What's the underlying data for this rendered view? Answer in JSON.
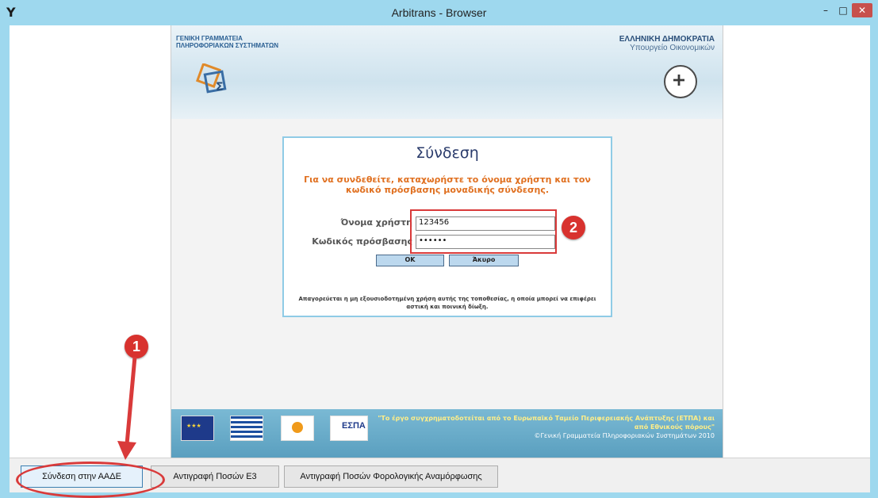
{
  "window": {
    "title": "Arbitrans - Browser",
    "app_icon": "Y",
    "min_label": "–",
    "max_label": "□",
    "close_label": "✕"
  },
  "header": {
    "org_left_line1": "ΓΕΝΙΚΗ ΓΡΑΜΜΑΤΕΙΑ",
    "org_left_line2": "ΠΛΗΡΟΦΟΡΙΑΚΩΝ ΣΥΣΤΗΜΑΤΩΝ",
    "org_right_line1": "ΕΛΛΗΝΙΚΗ ΔΗΜΟΚΡΑΤΙΑ",
    "org_right_line2": "Υπουργείο Οικονομικών"
  },
  "login": {
    "title": "Σύνδεση",
    "instruction": "Για να συνδεθείτε, καταχωρήστε το όνομα χρήστη και τον κωδικό πρόσβασης μοναδικής σύνδεσης.",
    "username_label": "Όνομα χρήστη",
    "username_value": "123456",
    "password_label": "Κωδικός πρόσβασης",
    "password_value": "••••••",
    "ok_label": "OK",
    "cancel_label": "Άκυρο",
    "warning": "Απαγορεύεται η μη εξουσιοδοτημένη χρήση αυτής της τοποθεσίας, η οποία μπορεί να επιφέρει αστική και ποινική δίωξη."
  },
  "footer": {
    "espa_label": "ΕΣΠΑ",
    "funding_text": "\"Το έργο συγχρηματοδοτείται από το Ευρωπαϊκό Ταμείο Περιφερειακής Ανάπτυξης (ΕΤΠΑ) και από Εθνικούς πόρους\"",
    "copyright": "©Γενική Γραμματεία Πληροφοριακών Συστημάτων 2010"
  },
  "toolbar": {
    "connect_label": "Σύνδεση στην ΑΑΔΕ",
    "copy_e3_label": "Αντιγραφή Ποσών Ε3",
    "copy_tax_label": "Αντιγραφή Ποσών Φορολογικής Αναμόρφωσης"
  },
  "annotations": {
    "badge_1": "1",
    "badge_2": "2",
    "color": "#d93a3a"
  }
}
